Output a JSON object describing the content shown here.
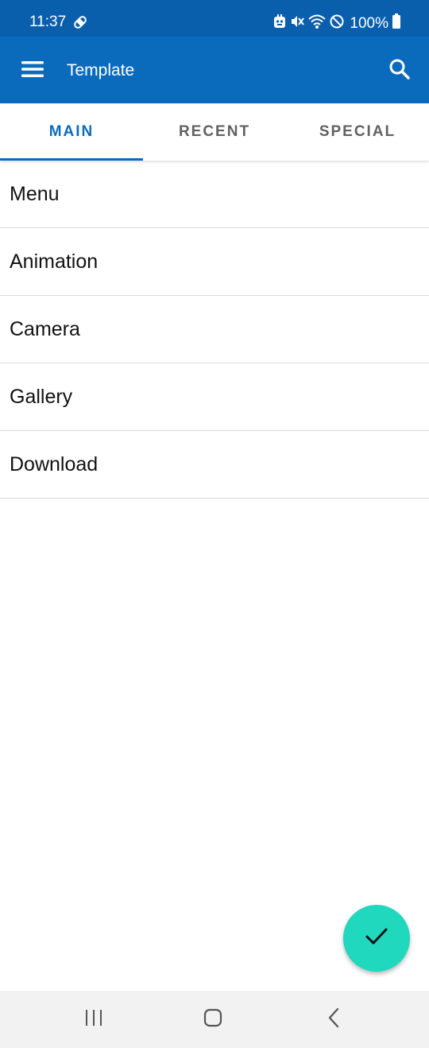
{
  "colors": {
    "status_bar": "#0a5fac",
    "app_bar": "#0a6bbd",
    "accent": "#0a6bbd",
    "fab": "#1fd8bd",
    "nav_bar": "#f2f2f2"
  },
  "status_bar": {
    "time": "11:37",
    "battery": "100%",
    "icons": [
      "bandage-icon",
      "app-notification-icon",
      "mute-vibrate-icon",
      "wifi-icon",
      "do-not-disturb-icon",
      "battery-icon"
    ]
  },
  "app_bar": {
    "title": "Template",
    "menu_icon": "hamburger-menu-icon",
    "search_icon": "search-icon"
  },
  "tabs": [
    {
      "label": "MAIN",
      "active": true
    },
    {
      "label": "RECENT",
      "active": false
    },
    {
      "label": "SPECIAL",
      "active": false
    }
  ],
  "list": {
    "items": [
      {
        "label": "Menu"
      },
      {
        "label": "Animation"
      },
      {
        "label": "Camera"
      },
      {
        "label": "Gallery"
      },
      {
        "label": "Download"
      }
    ]
  },
  "fab": {
    "icon": "check-icon"
  },
  "nav_bar": {
    "icons": [
      "recent-apps-icon",
      "home-icon",
      "back-icon"
    ]
  }
}
